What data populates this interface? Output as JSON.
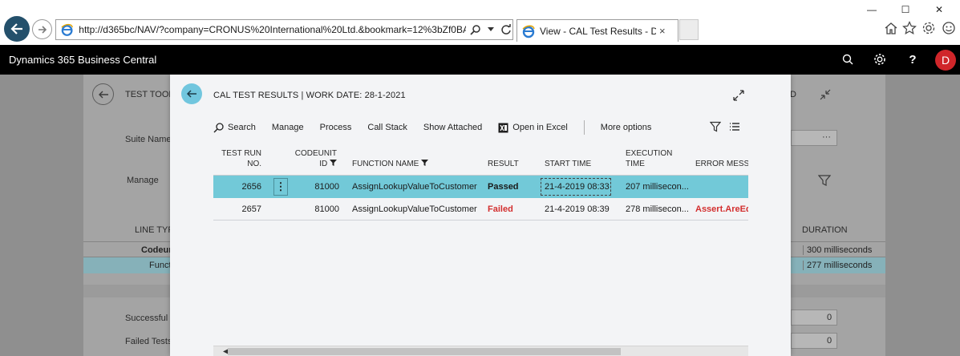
{
  "browser": {
    "url": "http://d365bc/NAV/?company=CRONUS%20International%20Ltd.&bookmark=12%3bZf0BAA",
    "tab_title": "View - CAL Test Results - D...",
    "tab_close": "×",
    "min_glyph": "—",
    "max_glyph": "☐",
    "close_glyph": "✕"
  },
  "bc": {
    "app_title": "Dynamics 365 Business Central",
    "avatar_initial": "D"
  },
  "background": {
    "title": "TEST TOOL",
    "title_right": "D",
    "suite_label": "Suite Name",
    "suite_dots": "···",
    "manage_label": "Manage",
    "line_type_header": "LINE TYP",
    "duration_header": "DURATION",
    "rows": [
      {
        "name": "Codeun",
        "duration": "300 milliseconds"
      },
      {
        "name": "Funct",
        "duration": "277 milliseconds"
      }
    ],
    "successful_label": "Successful T",
    "failed_label": "Failed Tests",
    "successful_value": "0",
    "failed_value": "0"
  },
  "dialog": {
    "title": "CAL TEST RESULTS | WORK DATE: 28-1-2021",
    "actions": {
      "search": "Search",
      "manage": "Manage",
      "process": "Process",
      "call_stack": "Call Stack",
      "show_attached": "Show Attached",
      "open_excel": "Open in Excel",
      "more_options": "More options"
    },
    "columns": {
      "test_run_no_1": "TEST RUN",
      "test_run_no_2": "NO.",
      "codeunit_id_1": "CODEUNIT",
      "codeunit_id_2": "ID",
      "function_name": "FUNCTION NAME",
      "result": "RESULT",
      "start_time": "START TIME",
      "execution_time_1": "EXECUTION",
      "execution_time_2": "TIME",
      "error_message": "ERROR MESS"
    },
    "rows": [
      {
        "test_run_no": "2656",
        "codeunit_id": "81000",
        "function_name": "AssignLookupValueToCustomer",
        "result": "Passed",
        "start_time": "21-4-2019 08:33",
        "execution_time": "207 millisecon...",
        "error_message": ""
      },
      {
        "test_run_no": "2657",
        "codeunit_id": "81000",
        "function_name": "AssignLookupValueToCustomer",
        "result": "Failed",
        "start_time": "21-4-2019 08:39",
        "execution_time": "278 millisecon...",
        "error_message": "Assert.AreEq"
      }
    ],
    "row_menu_glyph": "⋮"
  },
  "colors": {
    "selected_row": "#72c9d8",
    "failed_text": "#d32f2f",
    "avatar": "#d0262a",
    "bc_bar": "#000000"
  }
}
